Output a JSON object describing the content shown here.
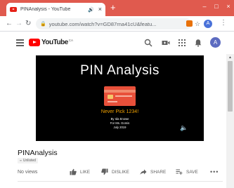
{
  "browser": {
    "tab_title": "PINAnalysis - YouTube",
    "tab_audio_glyph": "🔊",
    "tab_close": "×",
    "new_tab": "+",
    "url": "youtube.com/watch?v=GD87rna41cU&featu...",
    "profile_initial": "A",
    "window_buttons": [
      "–",
      "□",
      "×"
    ]
  },
  "masthead": {
    "logo_text": "YouTube",
    "country": "CA",
    "avatar_initial": "A"
  },
  "video": {
    "slide_title": "PIN Analysis",
    "slide_subtitle": "Never Pick 1234!",
    "credit_lines": [
      "By Ida Enowe",
      "For Ms. Gomis",
      "July 2019"
    ],
    "title": "PINAnalysis",
    "visibility_badge": "Unlisted",
    "views": "No views"
  },
  "actions": {
    "like": "LIKE",
    "dislike": "DISLIKE",
    "share": "SHARE",
    "save": "SAVE",
    "more": "•••"
  },
  "colors": {
    "titlebar": "#e05a4e",
    "youtube_red": "#ff0000",
    "slide_subtitle": "#f0a000"
  },
  "icons": [
    "youtube-favicon-icon",
    "speaker-icon",
    "back-arrow-icon",
    "forward-arrow-icon",
    "reload-icon",
    "lock-icon",
    "star-icon",
    "menu-icon",
    "search-icon",
    "create-video-icon",
    "apps-grid-icon",
    "bell-icon",
    "volume-icon",
    "thumbs-up-icon",
    "thumbs-down-icon",
    "share-icon",
    "playlist-add-icon",
    "more-icon"
  ]
}
